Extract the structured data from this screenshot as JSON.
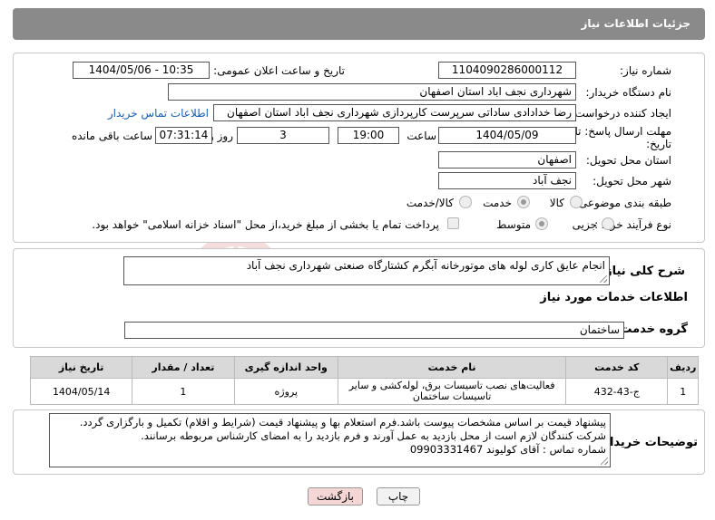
{
  "header": {
    "title": "جزئیات اطلاعات نیاز"
  },
  "form": {
    "need_number_label": "شماره نیاز:",
    "need_number": "1104090286000112",
    "announce_label": "تاریخ و ساعت اعلان عمومی:",
    "announce_value": "1404/05/06 - 10:35",
    "buyer_org_label": "نام دستگاه خریدار:",
    "buyer_org": "شهرداری نجف اباد استان اصفهان",
    "creator_label": "ایجاد کننده درخواست:",
    "creator": "رضا خدادادی ساداتی سرپرست  کارپردازی شهرداری نجف اباد استان اصفهان",
    "contact_link": "اطلاعات تماس خریدار",
    "deadline_label_1": "مهلت ارسال پاسخ: تا",
    "deadline_label_2": "تاریخ:",
    "deadline_date": "1404/05/09",
    "time_label": "ساعت",
    "deadline_time": "19:00",
    "days_value": "3",
    "days_label": "روز و",
    "remaining_time": "07:31:14",
    "remaining_label": "ساعت باقی مانده",
    "province_label": "استان محل تحویل:",
    "province": "اصفهان",
    "city_label": "شهر محل تحویل:",
    "city": "نجف آباد",
    "category_label": "طبقه بندی موضوعی:",
    "category_options": [
      "کالا",
      "خدمت",
      "کالا/خدمت"
    ],
    "category_selected": "خدمت",
    "process_label": "نوع فرآیند خرید :",
    "process_options": [
      "جزیی",
      "متوسط"
    ],
    "process_selected": "متوسط",
    "payment_note": "پرداخت تمام یا بخشی از مبلغ خرید،از محل \"اسناد خزانه اسلامی\" خواهد بود."
  },
  "summary": {
    "label": "شرح کلی نیاز:",
    "text": "انجام عایق کاری لوله های موتورخانه آبگرم کشتارگاه صنعتی شهرداری نجف آباد"
  },
  "services": {
    "section_title": "اطلاعات خدمات مورد نیاز",
    "group_label": "گروه خدمت:",
    "group_value": "ساختمان",
    "columns": [
      "ردیف",
      "کد خدمت",
      "نام خدمت",
      "واحد اندازه گیری",
      "تعداد / مقدار",
      "تاریخ نیاز"
    ],
    "rows": [
      [
        "1",
        "ج-43-432",
        "فعالیت‌های نصب تاسیسات برق، لوله‌کشی و سایر تاسیسات ساختمان",
        "پروژه",
        "1",
        "1404/05/14"
      ]
    ]
  },
  "buyer_notes": {
    "label": "توضیحات خریدار:",
    "lines": [
      "پیشنهاد قیمت بر اساس مشخصات پیوست باشد.فرم استعلام بها و پیشنهاد قیمت (شرایط و اقلام) تکمیل و بارگزاری گردد.",
      "شرکت کنندگان لازم است از محل بازدید به عمل آورند و فرم بازدید را به امضای کارشناس مربوطه برسانند.",
      "شماره تماس : آقای کولیوند 09903331467"
    ]
  },
  "buttons": {
    "print": "چاپ",
    "back": "بازگشت"
  },
  "watermark": {
    "text": "AriaTender.neT"
  },
  "colors": {
    "header_bg": "#8a8a8a",
    "link": "#1a5fb4",
    "back_button_bg": "#f4d6d6"
  }
}
